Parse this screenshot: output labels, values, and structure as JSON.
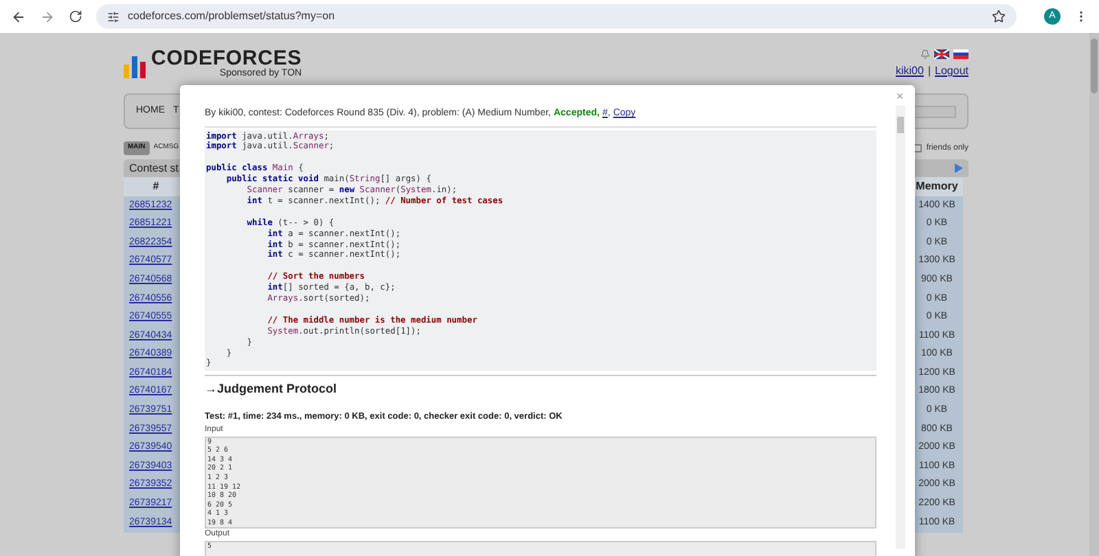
{
  "browser": {
    "url": "codeforces.com/problemset/status?my=on",
    "avatar": "A"
  },
  "header": {
    "logo_word": "CODEFORCES",
    "sponsor": "Sponsored by TON",
    "user": "kiki00",
    "separator": "|",
    "logout": "Logout"
  },
  "nav": {
    "items": [
      "HOME",
      "T"
    ]
  },
  "tabs": [
    {
      "label": "MAIN",
      "selected": true
    },
    {
      "label": "ACMSG",
      "selected": false
    }
  ],
  "friends_only": {
    "label": "friends only",
    "checked": false
  },
  "table": {
    "title": "Contest st",
    "columns": [
      "#",
      "Memory"
    ],
    "rows": [
      {
        "id": "26851232",
        "memory": "1400 KB"
      },
      {
        "id": "26851221",
        "memory": "0 KB"
      },
      {
        "id": "26822354",
        "memory": "0 KB"
      },
      {
        "id": "26740577",
        "memory": "1300 KB"
      },
      {
        "id": "26740568",
        "memory": "900 KB"
      },
      {
        "id": "26740556",
        "memory": "0 KB"
      },
      {
        "id": "26740555",
        "memory": "0 KB"
      },
      {
        "id": "26740434",
        "memory": "1100 KB"
      },
      {
        "id": "26740389",
        "memory": "100 KB"
      },
      {
        "id": "26740184",
        "memory": "1200 KB"
      },
      {
        "id": "26740167",
        "memory": "1800 KB"
      },
      {
        "id": "26739751",
        "memory": "0 KB"
      },
      {
        "id": "26739557",
        "memory": "800 KB"
      },
      {
        "id": "26739540",
        "memory": "2000 KB"
      },
      {
        "id": "26739403",
        "memory": "1100 KB"
      },
      {
        "id": "26739352",
        "memory": "2000 KB"
      },
      {
        "id": "26739217",
        "memory": "2200 KB"
      },
      {
        "id": "26739134",
        "memory": "1100 KB"
      }
    ]
  },
  "modal": {
    "close": "×",
    "info": {
      "text": "By kiki00, contest: Codeforces Round 835 (Div. 4), problem: (A) Medium Number,",
      "verdict": "Accepted,",
      "links": [
        "#",
        "Copy"
      ],
      "link_separator": ","
    },
    "code": [
      {
        "kind": "code",
        "tokens": [
          {
            "t": "import",
            "kind": "kw"
          },
          {
            "t": " java.util.",
            "kind": "plain"
          },
          {
            "t": "Arrays",
            "kind": "type"
          },
          {
            "t": ";",
            "kind": "plain"
          }
        ]
      },
      {
        "kind": "code",
        "tokens": [
          {
            "t": "import",
            "kind": "kw"
          },
          {
            "t": " java.util.",
            "kind": "plain"
          },
          {
            "t": "Scanner",
            "kind": "type"
          },
          {
            "t": ";",
            "kind": "plain"
          }
        ]
      },
      {
        "kind": "blank"
      },
      {
        "kind": "code",
        "tokens": [
          {
            "t": "public class",
            "kind": "kw"
          },
          {
            "t": " Main",
            "kind": "type"
          },
          {
            "t": " {",
            "kind": "plain"
          }
        ]
      },
      {
        "kind": "code",
        "tokens": [
          {
            "t": "    public static void",
            "kind": "kw"
          },
          {
            "t": " main(",
            "kind": "plain"
          },
          {
            "t": "String",
            "kind": "type"
          },
          {
            "t": "[] args) {",
            "kind": "plain"
          }
        ]
      },
      {
        "kind": "code",
        "tokens": [
          {
            "t": "        Scanner",
            "kind": "type"
          },
          {
            "t": " scanner = ",
            "kind": "plain"
          },
          {
            "t": "new",
            "kind": "kw"
          },
          {
            "t": " Scanner",
            "kind": "type"
          },
          {
            "t": "(",
            "kind": "plain"
          },
          {
            "t": "System",
            "kind": "type"
          },
          {
            "t": ".in);",
            "kind": "plain"
          }
        ]
      },
      {
        "kind": "code",
        "tokens": [
          {
            "t": "        int",
            "kind": "kw"
          },
          {
            "t": " t = scanner.nextInt(); ",
            "kind": "plain"
          },
          {
            "t": "// Number of test cases",
            "kind": "com"
          }
        ]
      },
      {
        "kind": "blank"
      },
      {
        "kind": "code",
        "tokens": [
          {
            "t": "        while",
            "kind": "kw"
          },
          {
            "t": " (t-- > 0) {",
            "kind": "plain"
          }
        ]
      },
      {
        "kind": "code",
        "tokens": [
          {
            "t": "            int",
            "kind": "kw"
          },
          {
            "t": " a = scanner.nextInt();",
            "kind": "plain"
          }
        ]
      },
      {
        "kind": "code",
        "tokens": [
          {
            "t": "            int",
            "kind": "kw"
          },
          {
            "t": " b = scanner.nextInt();",
            "kind": "plain"
          }
        ]
      },
      {
        "kind": "code",
        "tokens": [
          {
            "t": "            int",
            "kind": "kw"
          },
          {
            "t": " c = scanner.nextInt();",
            "kind": "plain"
          }
        ]
      },
      {
        "kind": "blank"
      },
      {
        "kind": "code",
        "tokens": [
          {
            "t": "            // Sort the numbers",
            "kind": "com"
          }
        ]
      },
      {
        "kind": "code",
        "tokens": [
          {
            "t": "            int",
            "kind": "kw"
          },
          {
            "t": "[] sorted = {a, b, c};",
            "kind": "plain"
          }
        ]
      },
      {
        "kind": "code",
        "tokens": [
          {
            "t": "            Arrays",
            "kind": "type"
          },
          {
            "t": ".sort(sorted);",
            "kind": "plain"
          }
        ]
      },
      {
        "kind": "blank"
      },
      {
        "kind": "code",
        "tokens": [
          {
            "t": "            // The middle number is the medium number",
            "kind": "com"
          }
        ]
      },
      {
        "kind": "code",
        "tokens": [
          {
            "t": "            System",
            "kind": "type"
          },
          {
            "t": ".out.println(sorted[1]);",
            "kind": "plain"
          }
        ]
      },
      {
        "kind": "code",
        "tokens": [
          {
            "t": "        }",
            "kind": "plain"
          }
        ]
      },
      {
        "kind": "code",
        "tokens": [
          {
            "t": "    }",
            "kind": "plain"
          }
        ]
      },
      {
        "kind": "code",
        "tokens": [
          {
            "t": "}",
            "kind": "plain"
          }
        ]
      }
    ],
    "protocol_title": "→Judgement Protocol",
    "test_line": "Test: #1, time: 234 ms., memory: 0 KB, exit code: 0, checker exit code: 0, verdict: OK",
    "input_label": "Input",
    "input": [
      "9",
      "5 2 6",
      "14 3 4",
      "20 2 1",
      "1 2 3",
      "11 19 12",
      "10 8 20",
      "6 20 5",
      "4 1 3",
      "19 8 4"
    ],
    "output_label": "Output",
    "output": [
      "5"
    ]
  }
}
